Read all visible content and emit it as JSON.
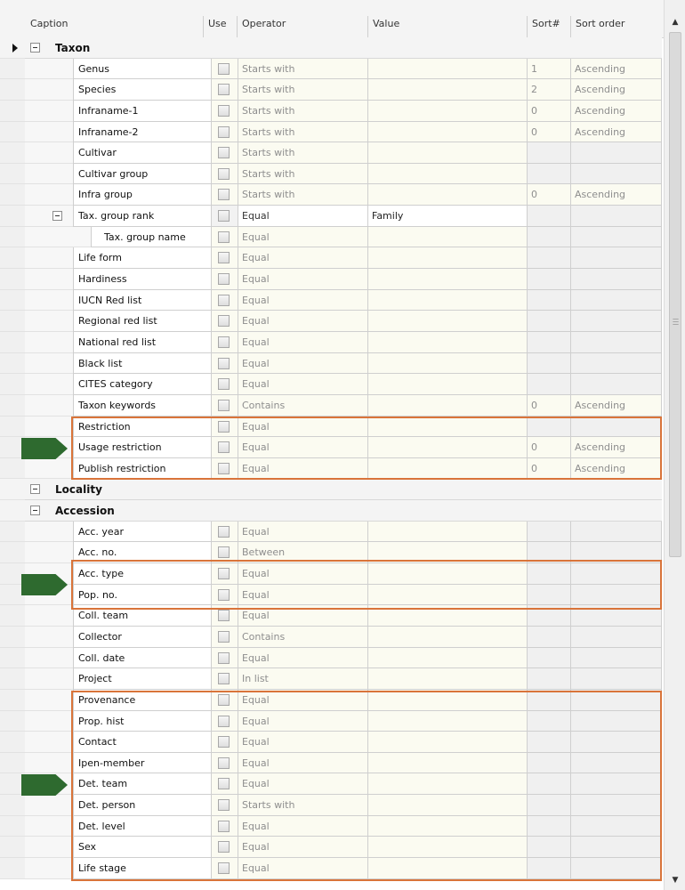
{
  "columns": {
    "caption": "Caption",
    "use": "Use",
    "operator": "Operator",
    "value": "Value",
    "sort_num": "Sort#",
    "sort_order": "Sort order"
  },
  "groups": {
    "taxon": "Taxon",
    "locality": "Locality",
    "accession": "Accession"
  },
  "taxon_rows": [
    {
      "caption": "Genus",
      "operator": "Starts with",
      "value": "",
      "sort": "1",
      "order": "Ascending"
    },
    {
      "caption": "Species",
      "operator": "Starts with",
      "value": "",
      "sort": "2",
      "order": "Ascending"
    },
    {
      "caption": "Infraname-1",
      "operator": "Starts with",
      "value": "",
      "sort": "0",
      "order": "Ascending"
    },
    {
      "caption": "Infraname-2",
      "operator": "Starts with",
      "value": "",
      "sort": "0",
      "order": "Ascending"
    },
    {
      "caption": "Cultivar",
      "operator": "Starts with",
      "value": "",
      "sort": "",
      "order": ""
    },
    {
      "caption": "Cultivar group",
      "operator": "Starts with",
      "value": "",
      "sort": "",
      "order": ""
    },
    {
      "caption": "Infra group",
      "operator": "Starts with",
      "value": "",
      "sort": "0",
      "order": "Ascending"
    },
    {
      "caption": "Tax. group rank",
      "operator": "Equal",
      "value": "Family",
      "sort": "",
      "order": ""
    },
    {
      "caption": "Tax. group name",
      "operator": "Equal",
      "value": "",
      "sort": "",
      "order": ""
    },
    {
      "caption": "Life form",
      "operator": "Equal",
      "value": "",
      "sort": "",
      "order": ""
    },
    {
      "caption": "Hardiness",
      "operator": "Equal",
      "value": "",
      "sort": "",
      "order": ""
    },
    {
      "caption": "IUCN Red list",
      "operator": "Equal",
      "value": "",
      "sort": "",
      "order": ""
    },
    {
      "caption": "Regional red list",
      "operator": "Equal",
      "value": "",
      "sort": "",
      "order": ""
    },
    {
      "caption": "National red list",
      "operator": "Equal",
      "value": "",
      "sort": "",
      "order": ""
    },
    {
      "caption": "Black list",
      "operator": "Equal",
      "value": "",
      "sort": "",
      "order": ""
    },
    {
      "caption": "CITES category",
      "operator": "Equal",
      "value": "",
      "sort": "",
      "order": ""
    },
    {
      "caption": "Taxon keywords",
      "operator": "Contains",
      "value": "",
      "sort": "0",
      "order": "Ascending"
    },
    {
      "caption": "Restriction",
      "operator": "Equal",
      "value": "",
      "sort": "",
      "order": ""
    },
    {
      "caption": "Usage restriction",
      "operator": "Equal",
      "value": "",
      "sort": "0",
      "order": "Ascending"
    },
    {
      "caption": "Publish restriction",
      "operator": "Equal",
      "value": "",
      "sort": "0",
      "order": "Ascending"
    }
  ],
  "accession_rows": [
    {
      "caption": "Acc. year",
      "operator": "Equal",
      "value": "",
      "sort": "",
      "order": ""
    },
    {
      "caption": "Acc. no.",
      "operator": "Between",
      "value": "",
      "sort": "",
      "order": ""
    },
    {
      "caption": "Acc. type",
      "operator": "Equal",
      "value": "",
      "sort": "",
      "order": ""
    },
    {
      "caption": "Pop. no.",
      "operator": "Equal",
      "value": "",
      "sort": "",
      "order": ""
    },
    {
      "caption": "Coll. team",
      "operator": "Equal",
      "value": "",
      "sort": "",
      "order": ""
    },
    {
      "caption": "Collector",
      "operator": "Contains",
      "value": "",
      "sort": "",
      "order": ""
    },
    {
      "caption": "Coll. date",
      "operator": "Equal",
      "value": "",
      "sort": "",
      "order": ""
    },
    {
      "caption": "Project",
      "operator": "In list",
      "value": "",
      "sort": "",
      "order": ""
    },
    {
      "caption": "Provenance",
      "operator": "Equal",
      "value": "",
      "sort": "",
      "order": ""
    },
    {
      "caption": "Prop. hist",
      "operator": "Equal",
      "value": "",
      "sort": "",
      "order": ""
    },
    {
      "caption": "Contact",
      "operator": "Equal",
      "value": "",
      "sort": "",
      "order": ""
    },
    {
      "caption": "Ipen-member",
      "operator": "Equal",
      "value": "",
      "sort": "",
      "order": ""
    },
    {
      "caption": "Det. team",
      "operator": "Equal",
      "value": "",
      "sort": "",
      "order": ""
    },
    {
      "caption": "Det. person",
      "operator": "Starts with",
      "value": "",
      "sort": "",
      "order": ""
    },
    {
      "caption": "Det. level",
      "operator": "Equal",
      "value": "",
      "sort": "",
      "order": ""
    },
    {
      "caption": "Sex",
      "operator": "Equal",
      "value": "",
      "sort": "",
      "order": ""
    },
    {
      "caption": "Life stage",
      "operator": "Equal",
      "value": "",
      "sort": "",
      "order": ""
    }
  ],
  "colors": {
    "highlight": "#d9743a",
    "arrow": "#2e6a2f"
  }
}
